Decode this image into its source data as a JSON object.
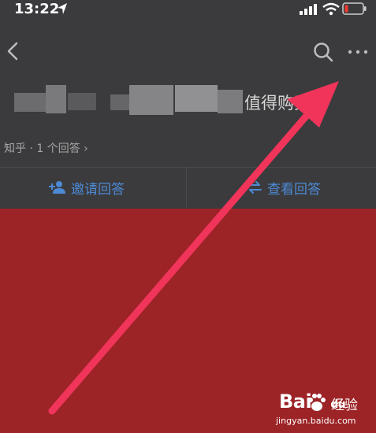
{
  "status_bar": {
    "time": "13:22",
    "icons": [
      "location-arrow-icon",
      "cellular-signal-icon",
      "wifi-icon",
      "battery-low-icon"
    ],
    "battery_color": "#ff3b30"
  },
  "nav": {
    "icons": [
      "back-chevron-icon",
      "search-icon",
      "more-dots-icon"
    ]
  },
  "question": {
    "title_visible": "值得购买",
    "meta": "知乎 · 1 个回答 ›"
  },
  "actions": {
    "invite_label": "邀请回答",
    "invite_icon": "add-person-icon",
    "view_label": "查看回答",
    "view_icon": "swap-arrows-icon"
  },
  "colors": {
    "header_bg": "#3b3b3d",
    "content_bg": "#9c2326",
    "accent_blue": "#4d8ad6",
    "arrow": "#f0345a"
  },
  "watermark": {
    "logo": "Bai",
    "logo_suffix": "du",
    "text": "经验",
    "url": "jingyan.baidu.com"
  }
}
